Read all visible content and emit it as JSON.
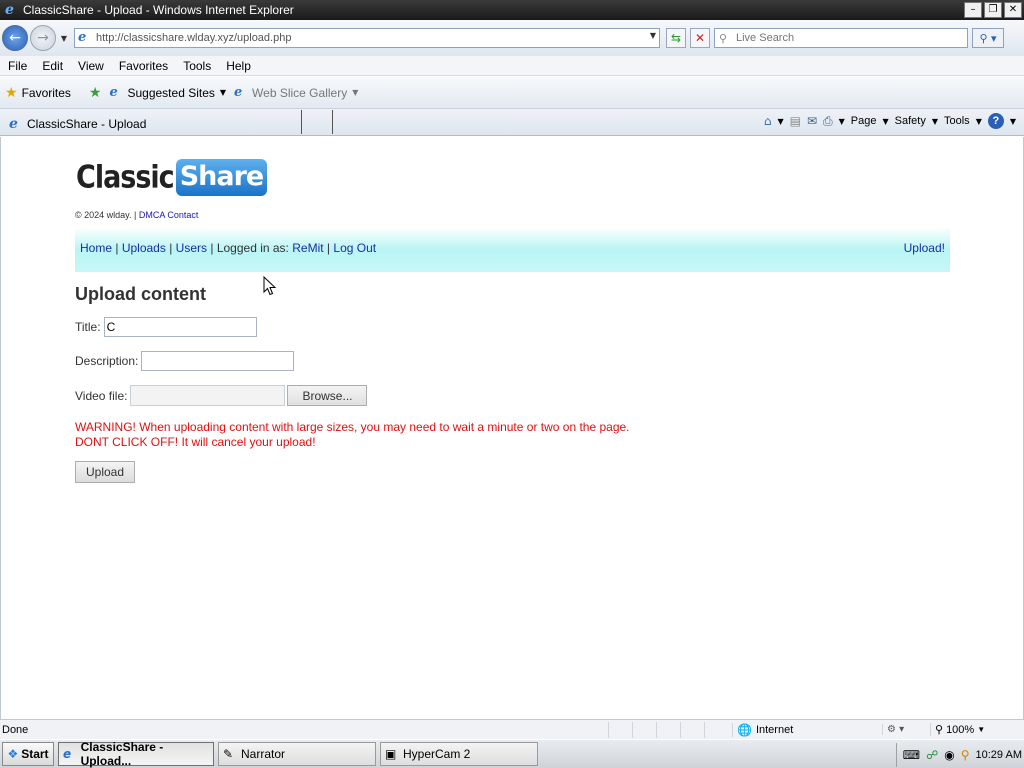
{
  "window": {
    "title": "ClassicShare - Upload - Windows Internet Explorer",
    "minimize_glyph": "–",
    "restore_glyph": "❐",
    "close_glyph": "✕"
  },
  "address_bar": {
    "url": "http://classicshare.wlday.xyz/upload.php",
    "search_placeholder": "Live Search"
  },
  "menu": [
    "File",
    "Edit",
    "View",
    "Favorites",
    "Tools",
    "Help"
  ],
  "favorites_bar": {
    "favorites_label": "Favorites",
    "items": [
      {
        "label": "Suggested Sites",
        "enabled": true
      },
      {
        "label": "Web Slice Gallery",
        "enabled": false
      }
    ]
  },
  "tab": {
    "title": "ClassicShare - Upload"
  },
  "command_bar": {
    "page": "Page",
    "safety": "Safety",
    "tools": "Tools",
    "help": "?"
  },
  "page": {
    "logo": {
      "part1": "Classic",
      "part2": "Share"
    },
    "copyright": "© 2024 wlday.",
    "separator": " | ",
    "dmca_link": "DMCA Contact",
    "nav": {
      "home": "Home",
      "uploads": "Uploads",
      "users": "Users",
      "logged_in_prefix": "Logged in as:",
      "username": "ReMit",
      "logout": "Log Out",
      "upload": "Upload!"
    },
    "heading": "Upload content",
    "form": {
      "title_label": "Title:",
      "title_value": "C",
      "description_label": "Description:",
      "description_value": "",
      "video_label": "Video file:",
      "browse_label": "Browse...",
      "upload_label": "Upload"
    },
    "warning_line1": "WARNING! When uploading content with large sizes, you may need to wait a minute or two on the page.",
    "warning_line2": "DONT CLICK OFF! It will cancel your upload!"
  },
  "status_bar": {
    "status": "Done",
    "zone": "Internet",
    "zoom": "100%"
  },
  "taskbar": {
    "start": "Start",
    "items": [
      {
        "label": "ClassicShare - Upload...",
        "active": true
      },
      {
        "label": "Narrator",
        "active": false
      },
      {
        "label": "HyperCam 2",
        "active": false
      }
    ],
    "clock": "10:29 AM"
  },
  "colors": {
    "warning": "#e01010",
    "link": "#1a2fa0",
    "nav_background": "#b9f5f5",
    "logo_share_bg": "#1a73c7"
  }
}
